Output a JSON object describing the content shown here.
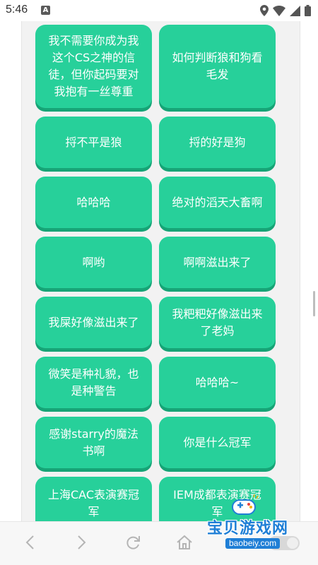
{
  "status_bar": {
    "time": "5:46",
    "app_icon_letter": "A"
  },
  "buttons": [
    {
      "label": "我不需要你成为我这个CS之神的信徒，但你起码要对我抱有一丝尊重"
    },
    {
      "label": "如何判断狼和狗看毛发"
    },
    {
      "label": "捋不平是狼"
    },
    {
      "label": "捋的好是狗"
    },
    {
      "label": "哈哈哈"
    },
    {
      "label": "绝对的滔天大畜啊"
    },
    {
      "label": "啊哟"
    },
    {
      "label": "啊啊滋出来了"
    },
    {
      "label": "我屎好像滋出来了"
    },
    {
      "label": "我粑粑好像滋出来了老妈"
    },
    {
      "label": "微笑是种礼貌，也是种警告"
    },
    {
      "label": "哈哈哈~"
    },
    {
      "label": "感谢starry的魔法书啊"
    },
    {
      "label": "你是什么冠军"
    },
    {
      "label": "上海CAC表演赛冠军"
    },
    {
      "label": "IEM成都表演赛冠军"
    }
  ],
  "watermark": {
    "title": "宝贝游戏网",
    "url": "baobeiy.com"
  },
  "colors": {
    "button_bg": "#27d09a",
    "button_shadow": "#16a476",
    "page_bg": "#f2f2f2"
  },
  "icons": {
    "nav": [
      "back-icon",
      "forward-icon",
      "refresh-icon",
      "home-icon",
      "toggle-switch"
    ]
  }
}
